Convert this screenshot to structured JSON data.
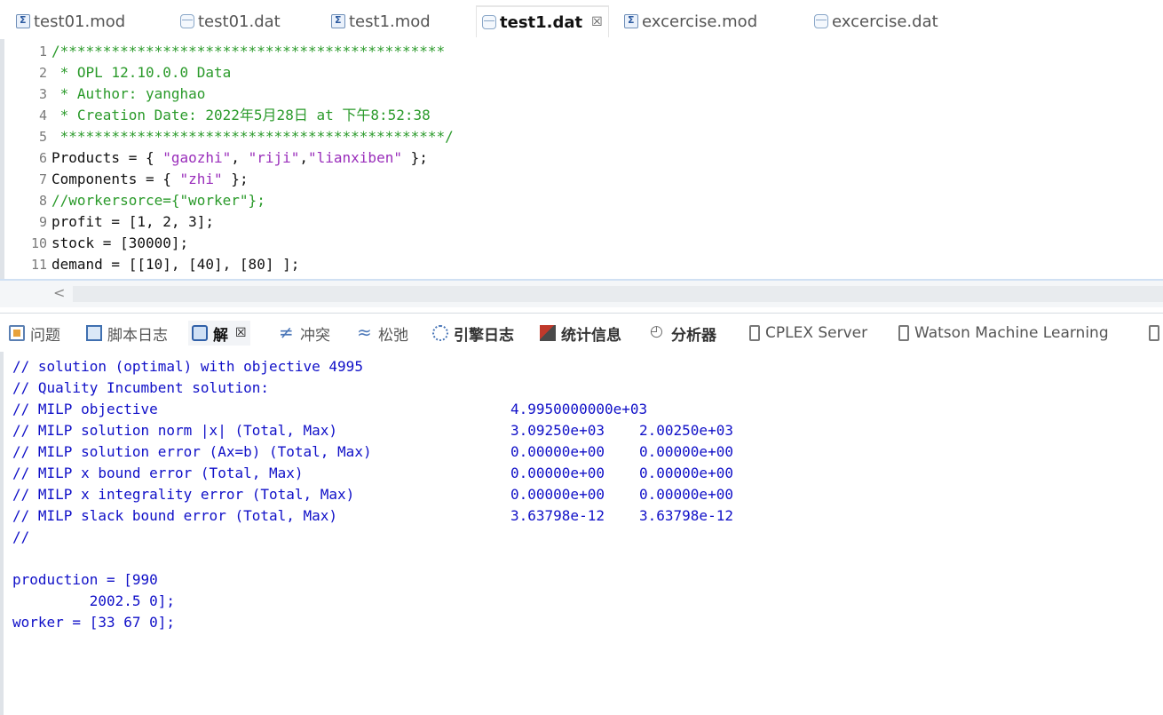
{
  "editor_tabs": [
    {
      "label": "test01.mod",
      "type": "mod"
    },
    {
      "label": "test01.dat",
      "type": "dat"
    },
    {
      "label": "test1.mod",
      "type": "mod"
    },
    {
      "label": "test1.dat",
      "type": "dat",
      "active": true,
      "close": "☒"
    },
    {
      "label": "excercise.mod",
      "type": "mod"
    },
    {
      "label": "excercise.dat",
      "type": "dat"
    }
  ],
  "editor": {
    "lines": [
      {
        "num": "1",
        "text": "/*********************************************"
      },
      {
        "num": "2",
        "text": " * OPL 12.10.0.0 Data"
      },
      {
        "num": "3",
        "text": " * Author: yanghao"
      },
      {
        "num": "4",
        "text": " * Creation Date: 2022年5月28日 at 下午8:52:38"
      },
      {
        "num": "5",
        "text": " *********************************************/"
      },
      {
        "num": "6",
        "a": "Products = { ",
        "s1": "\"gaozhi\"",
        "b": ", ",
        "s2": "\"riji\"",
        "c": ",",
        "s3": "\"lianxiben\"",
        "d": " };"
      },
      {
        "num": "7",
        "a": "Components = { ",
        "s1": "\"zhi\"",
        "b": " };"
      },
      {
        "num": "8",
        "text": "//workersorce={\"worker\"};"
      },
      {
        "num": "9",
        "text": "profit = [1, 2, 3];"
      },
      {
        "num": "10",
        "text": "stock = [30000];"
      },
      {
        "num": "11",
        "text": "demand = [[10], [40], [80] ];"
      }
    ],
    "scroll_left": "<"
  },
  "view_tabs": [
    {
      "label": "问题",
      "icon": "problems-icon"
    },
    {
      "label": "脚本日志",
      "icon": "script-log-icon"
    },
    {
      "label": "解",
      "icon": "solution-icon",
      "active": true,
      "close": "☒"
    },
    {
      "label": "冲突",
      "icon": "conflict-icon"
    },
    {
      "label": "松弛",
      "icon": "relaxation-icon"
    },
    {
      "label": "引擎日志",
      "icon": "engine-log-icon"
    },
    {
      "label": "统计信息",
      "icon": "statistics-icon"
    },
    {
      "label": "分析器",
      "icon": "profiler-icon"
    },
    {
      "label": "CPLEX Server",
      "icon": "server-icon"
    },
    {
      "label": "Watson Machine Learning",
      "icon": "server-icon"
    }
  ],
  "console": {
    "lines": [
      {
        "text": "// solution (optimal) with objective 4995"
      },
      {
        "text": "// Quality Incumbent solution:"
      },
      {
        "text": "// MILP objective",
        "v1": "4.9950000000e+03"
      },
      {
        "text": "// MILP solution norm |x| (Total, Max)",
        "v1": "3.09250e+03",
        "v2": "2.00250e+03"
      },
      {
        "text": "// MILP solution error (Ax=b) (Total, Max)",
        "v1": "0.00000e+00",
        "v2": "0.00000e+00"
      },
      {
        "text": "// MILP x bound error (Total, Max)",
        "v1": "0.00000e+00",
        "v2": "0.00000e+00"
      },
      {
        "text": "// MILP x integrality error (Total, Max)",
        "v1": "0.00000e+00",
        "v2": "0.00000e+00"
      },
      {
        "text": "// MILP slack bound error (Total, Max)",
        "v1": "3.63798e-12",
        "v2": "3.63798e-12"
      },
      {
        "text": "//"
      },
      {
        "text": ""
      },
      {
        "text": "production = [990"
      },
      {
        "text": "         2002.5 0];"
      },
      {
        "text": "worker = [33 67 0];"
      }
    ]
  }
}
